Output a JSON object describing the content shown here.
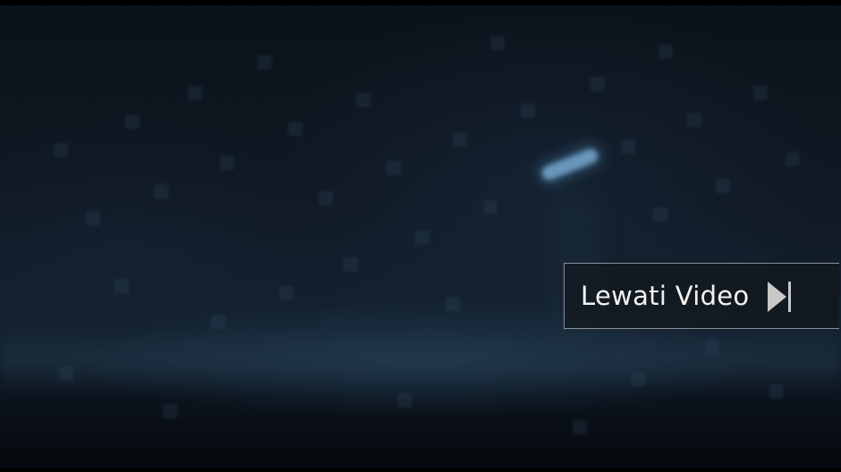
{
  "player": {
    "skip_label": "Lewati Video",
    "skip_icon": "skip-next-icon"
  },
  "colors": {
    "skip_text": "#f2f2f2",
    "skip_border": "#8a8f94",
    "skip_icon": "#c8c8c8"
  }
}
